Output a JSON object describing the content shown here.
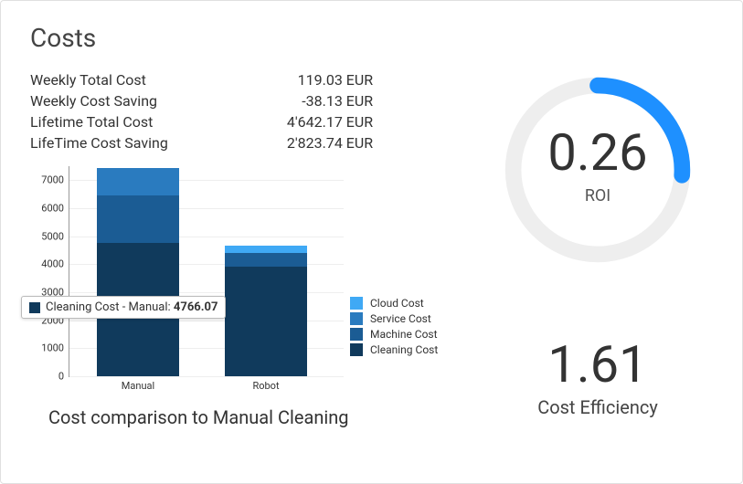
{
  "title": "Costs",
  "metrics": [
    {
      "label": "Weekly Total Cost",
      "value": "119.03 EUR"
    },
    {
      "label": "Weekly Cost Saving",
      "value": "-38.13 EUR"
    },
    {
      "label": "Lifetime Total Cost",
      "value": "4'642.17 EUR"
    },
    {
      "label": "LifeTime Cost Saving",
      "value": "2'823.74 EUR"
    }
  ],
  "gauge": {
    "value": "0.26",
    "label": "ROI",
    "ratio": 0.26
  },
  "kpi": {
    "value": "1.61",
    "label": "Cost Efficiency"
  },
  "chart_caption": "Cost comparison to Manual Cleaning",
  "legend": [
    {
      "name": "Cloud Cost",
      "color": "#3fa9f5"
    },
    {
      "name": "Service Cost",
      "color": "#2a7bbf"
    },
    {
      "name": "Machine Cost",
      "color": "#1b5c94"
    },
    {
      "name": "Cleaning Cost",
      "color": "#103a5c"
    }
  ],
  "tooltip": {
    "series": "Cleaning Cost",
    "category": "Manual",
    "value": "4766.07",
    "color": "#103a5c"
  },
  "chart_data": {
    "type": "bar",
    "stack": true,
    "categories": [
      "Manual",
      "Robot"
    ],
    "ylim": [
      0,
      7500
    ],
    "ticks": [
      0,
      1000,
      2000,
      3000,
      4000,
      5000,
      6000,
      7000
    ],
    "series": [
      {
        "name": "Cleaning Cost",
        "color": "#103a5c",
        "values": [
          4766.07,
          3900
        ]
      },
      {
        "name": "Machine Cost",
        "color": "#1b5c94",
        "values": [
          1700,
          500
        ]
      },
      {
        "name": "Service Cost",
        "color": "#2a7bbf",
        "values": [
          960,
          0
        ]
      },
      {
        "name": "Cloud Cost",
        "color": "#3fa9f5",
        "values": [
          0,
          250
        ]
      }
    ],
    "title": "Cost comparison to Manual Cleaning",
    "xlabel": "",
    "ylabel": ""
  }
}
